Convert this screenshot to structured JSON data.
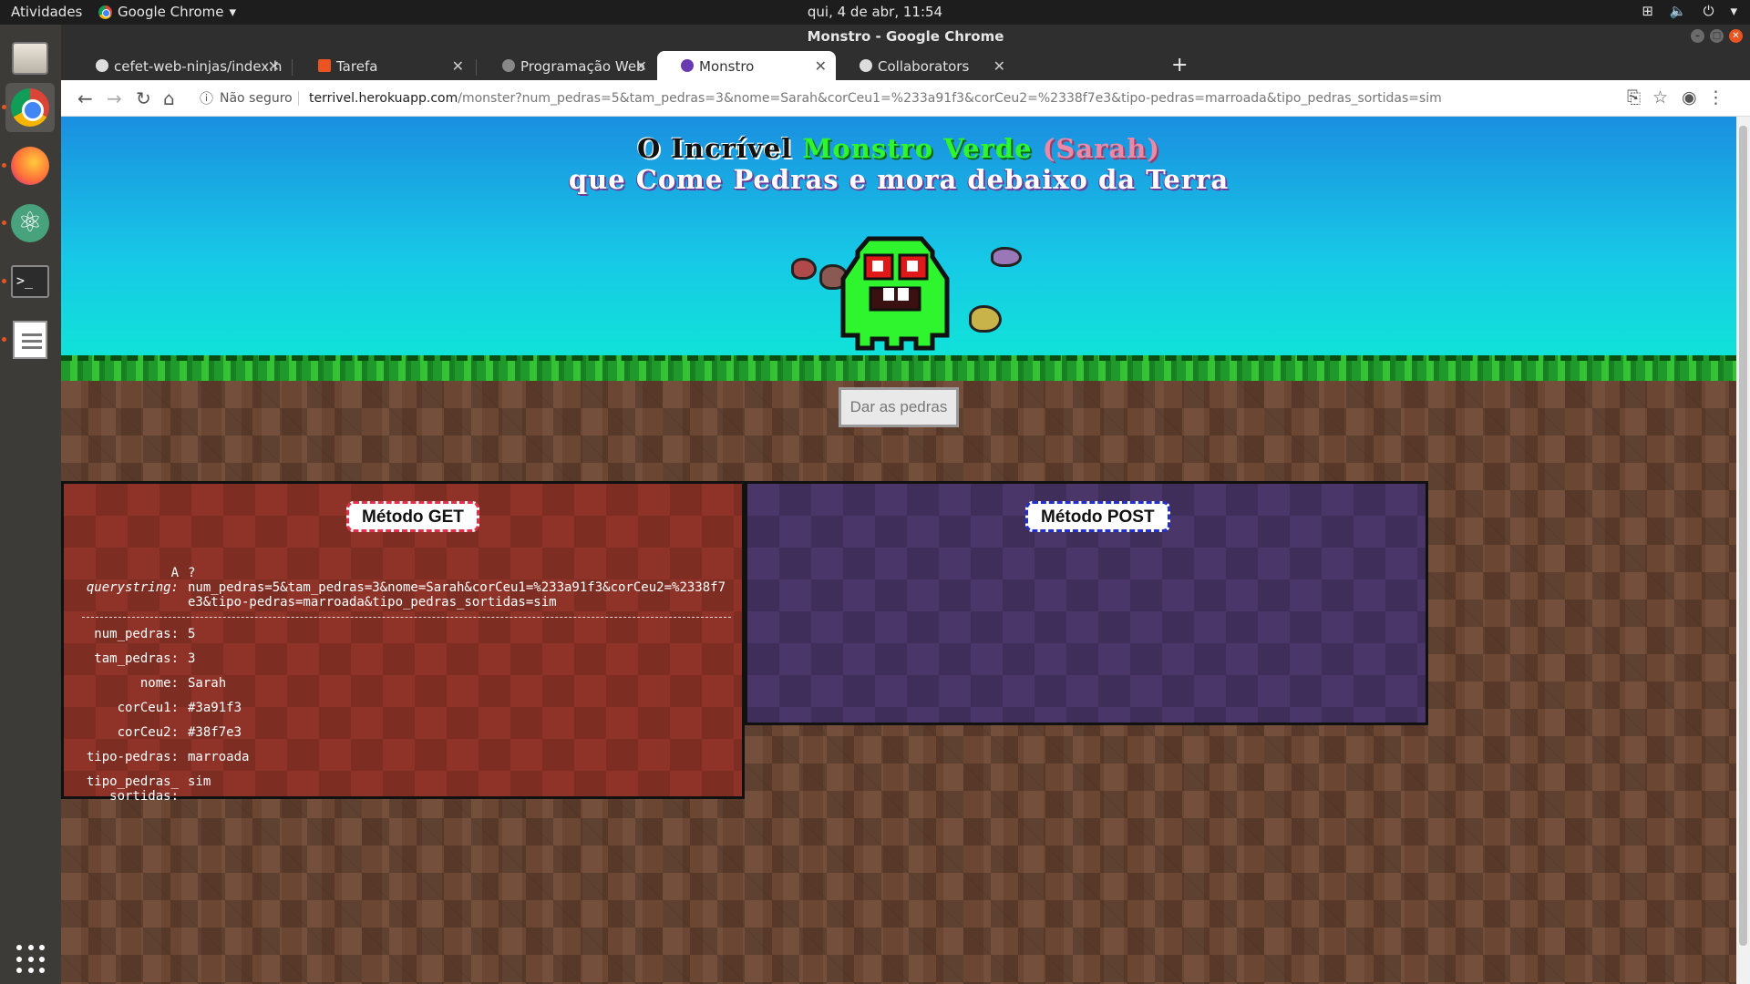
{
  "system": {
    "activities": "Atividades",
    "app_name": "Google Chrome",
    "clock": "qui,  4 de abr, 11:54"
  },
  "window": {
    "title": "Monstro - Google Chrome"
  },
  "tabs": [
    {
      "label": "cefet-web-ninjas/index.h",
      "active": false
    },
    {
      "label": "Tarefa",
      "active": false
    },
    {
      "label": "Programação Web",
      "active": false
    },
    {
      "label": "Monstro",
      "active": true
    },
    {
      "label": "Collaborators",
      "active": false
    }
  ],
  "address_bar": {
    "security_label": "Não seguro",
    "host": "terrivel.herokuapp.com",
    "path": "/monster?num_pedras=5&tam_pedras=3&nome=Sarah&corCeu1=%233a91f3&corCeu2=%2338f7e3&tipo-pedras=marroada&tipo_pedras_sortidas=sim"
  },
  "page": {
    "title_part1": "O Incrível ",
    "title_part2": "Monstro Verde",
    "title_part3": " (Sarah)",
    "subtitle": "que Come Pedras e mora debaixo da Terra",
    "give_button": "Dar as pedras",
    "get_panel": {
      "heading": "Método GET",
      "qs_label_a": "A",
      "qs_label_b": "querystring:",
      "qs_value_a": "?",
      "qs_value_b": "num_pedras=5&tam_pedras=3&nome=Sarah&corCeu1=%233a91f3&corCeu2=%2338f7e3&tipo-pedras=marroada&tipo_pedras_sortidas=sim",
      "params": [
        {
          "key": "num_pedras:",
          "value": "5"
        },
        {
          "key": "tam_pedras:",
          "value": "3"
        },
        {
          "key": "nome:",
          "value": "Sarah"
        },
        {
          "key": "corCeu1:",
          "value": "#3a91f3"
        },
        {
          "key": "corCeu2:",
          "value": "#38f7e3"
        },
        {
          "key": "tipo-pedras:",
          "value": "marroada"
        },
        {
          "key": "tipo_pedras_sortidas:",
          "value": "sim"
        }
      ]
    },
    "post_panel": {
      "heading": "Método POST"
    }
  },
  "colors": {
    "accent_orange": "#e95420",
    "monster_green": "#2ef52e",
    "get_panel": "#8f3328",
    "post_panel": "#4a3668"
  }
}
